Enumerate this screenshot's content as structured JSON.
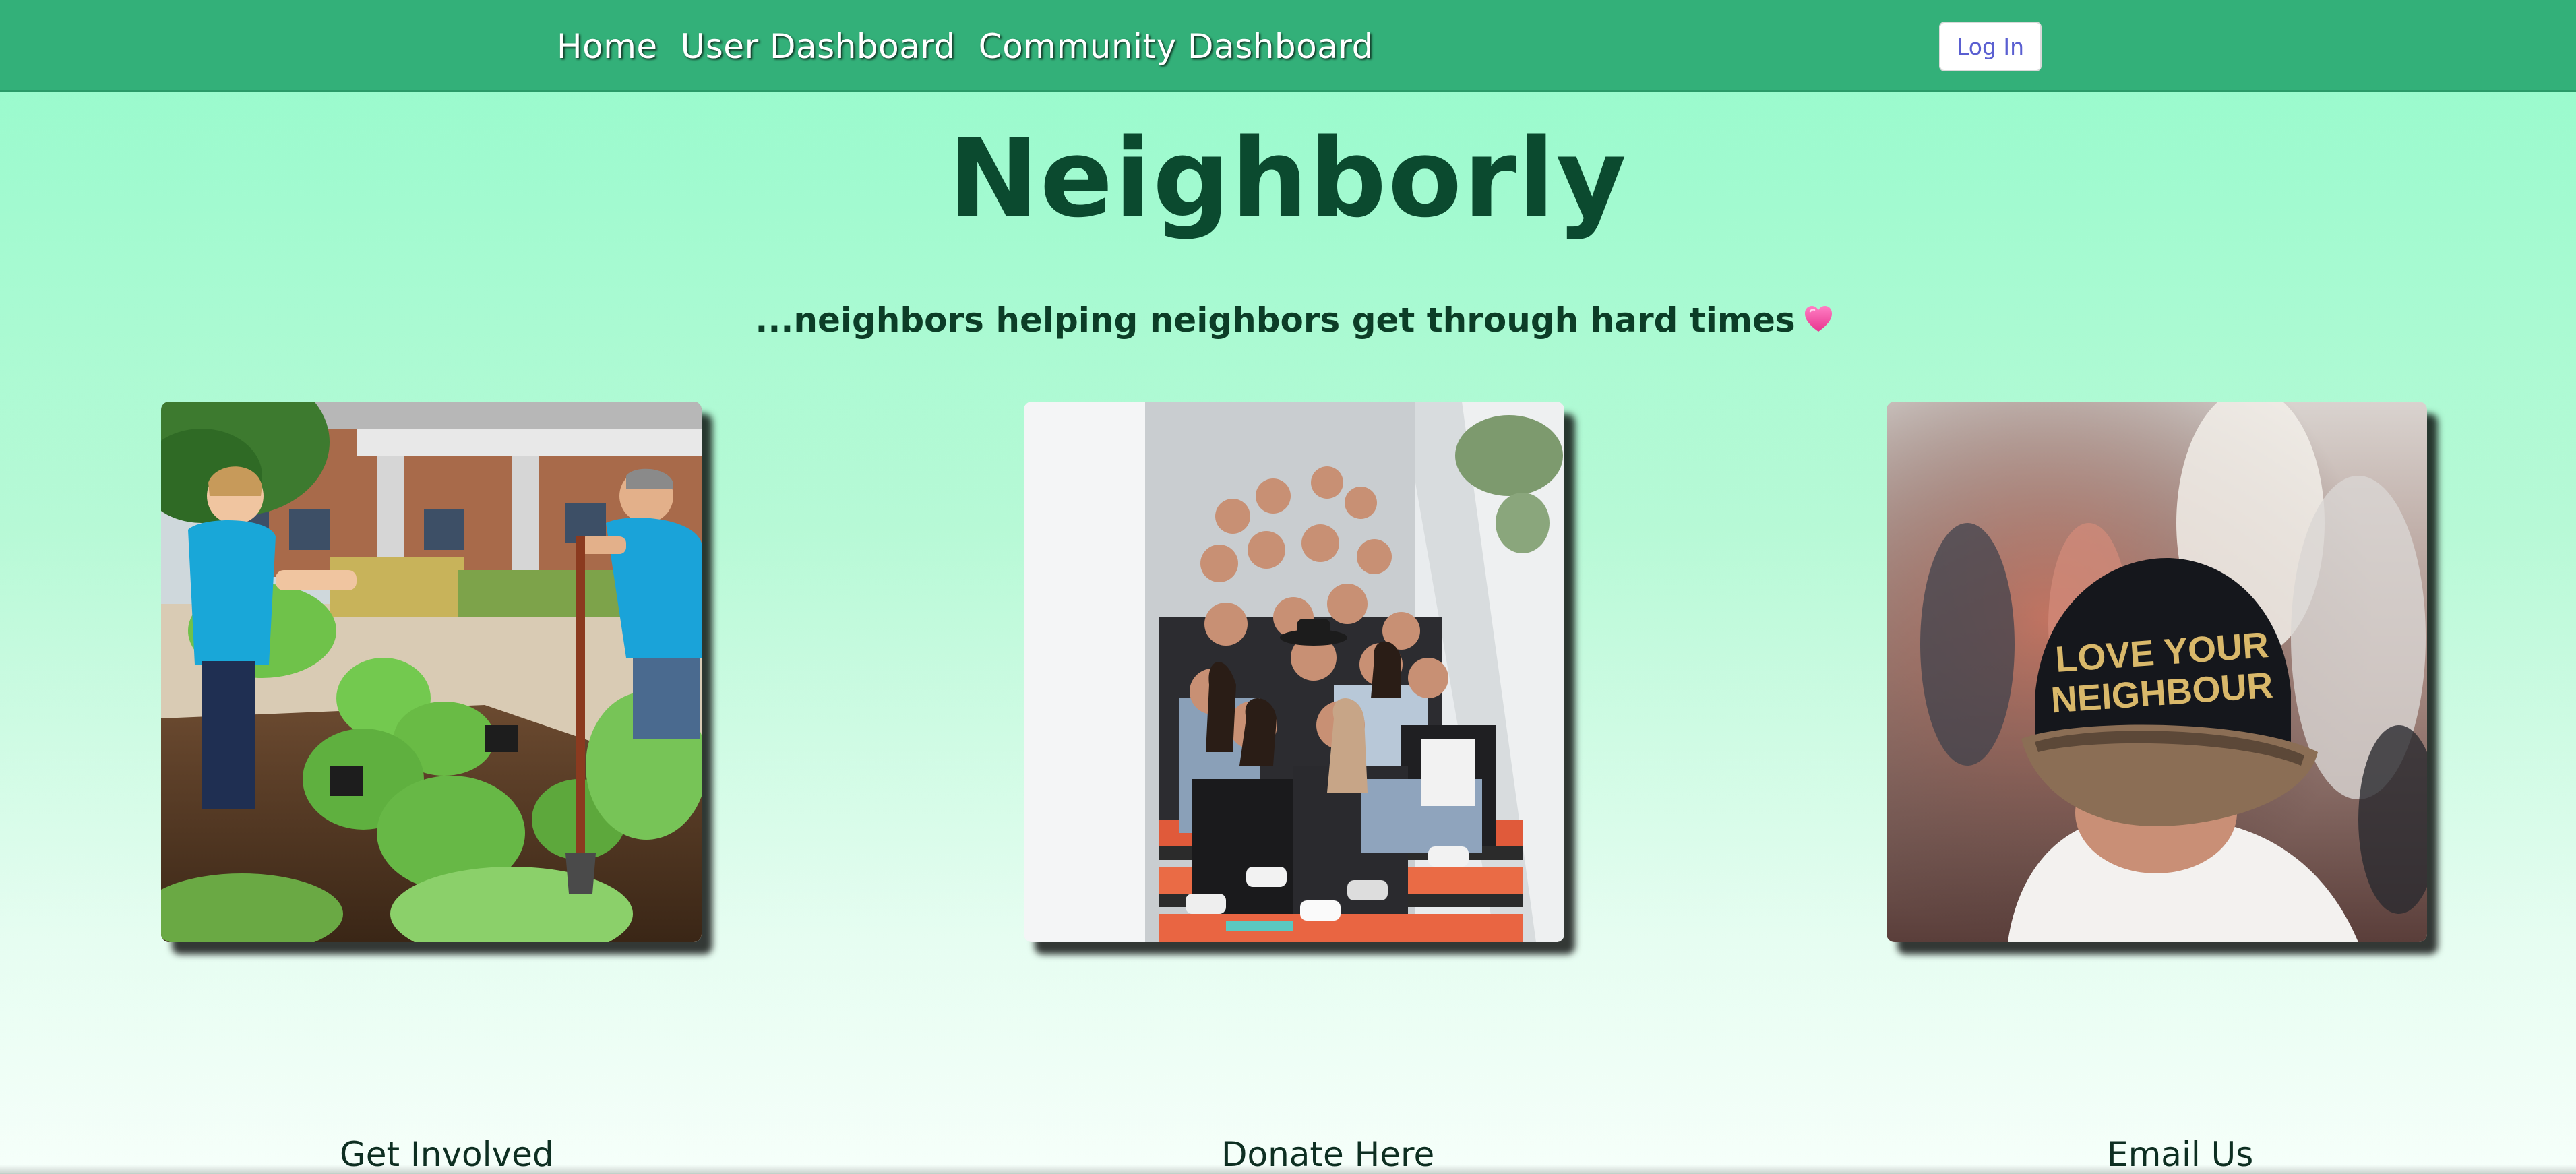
{
  "nav": {
    "links": [
      "Home",
      "User Dashboard",
      "Community Dashboard"
    ],
    "login_label": "Log In"
  },
  "hero": {
    "title": "Neighborly",
    "tagline": "...neighbors helping neighbors get through hard times",
    "tagline_icon": "heart-icon"
  },
  "photos": [
    {
      "name": "community-garden-photo",
      "text": ""
    },
    {
      "name": "group-of-friends-photo",
      "text": ""
    },
    {
      "name": "love-your-neighbour-cap-photo",
      "text": "LOVE YOUR NEIGHBOUR"
    }
  ],
  "footer": {
    "links": [
      "Get Involved",
      "Donate Here",
      "Email Us"
    ]
  },
  "colors": {
    "navbar": "#33b079",
    "title": "#0b4a2f",
    "login_text": "#5a5fd1",
    "background_top": "#95fbcc",
    "background_bottom": "#f6fffa"
  }
}
